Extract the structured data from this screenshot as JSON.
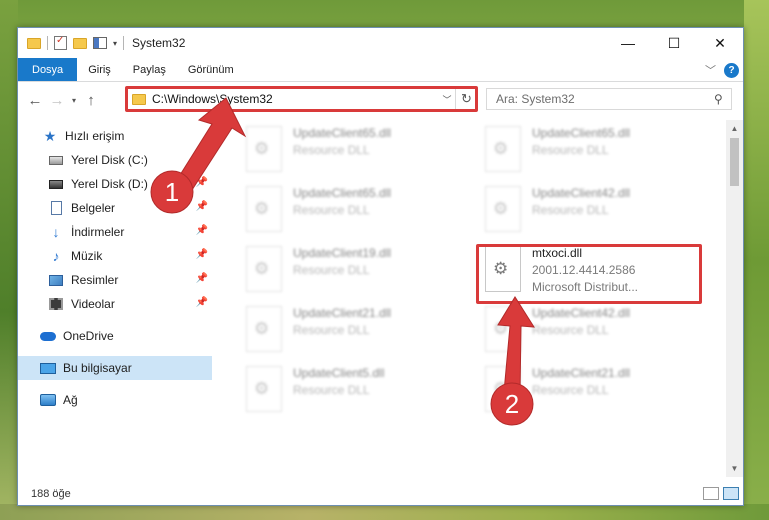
{
  "window": {
    "title": "System32",
    "controls": {
      "minimize": "—",
      "maximize": "☐",
      "close": "✕"
    }
  },
  "ribbon": {
    "tabs": [
      "Dosya",
      "Giriş",
      "Paylaş",
      "Görünüm"
    ],
    "help": "?"
  },
  "nav": {
    "address": "C:\\Windows\\System32",
    "search_placeholder": "Ara: System32"
  },
  "sidebar": {
    "items": [
      {
        "label": "Hızlı erişim",
        "icon": "star-icon"
      },
      {
        "label": "Yerel Disk (C:)",
        "icon": "disk-icon"
      },
      {
        "label": "Yerel Disk (D:)",
        "icon": "disk-icon"
      },
      {
        "label": "Belgeler",
        "icon": "documents-icon"
      },
      {
        "label": "İndirmeler",
        "icon": "download-icon"
      },
      {
        "label": "Müzik",
        "icon": "music-icon"
      },
      {
        "label": "Resimler",
        "icon": "pictures-icon"
      },
      {
        "label": "Videolar",
        "icon": "videos-icon"
      },
      {
        "label": "OneDrive",
        "icon": "cloud-icon"
      },
      {
        "label": "Bu bilgisayar",
        "icon": "computer-icon"
      },
      {
        "label": "Ağ",
        "icon": "network-icon"
      }
    ]
  },
  "files": [
    {
      "name": "UpdateClient65.dll",
      "type": "Resource DLL"
    },
    {
      "name": "UpdateClient65.dll",
      "type": "Resource DLL"
    },
    {
      "name": "UpdateClient65.dll",
      "type": "Resource DLL"
    },
    {
      "name": "UpdateClient42.dll",
      "type": "Resource DLL"
    },
    {
      "name": "UpdateClient19.dll",
      "type": "Resource DLL"
    },
    {
      "name": "mtxoci.dll",
      "version": "2001.12.4414.2586",
      "company": "Microsoft Distribut..."
    },
    {
      "name": "UpdateClient21.dll",
      "type": "Resource DLL"
    },
    {
      "name": "UpdateClient42.dll",
      "type": "Resource DLL"
    },
    {
      "name": "UpdateClient5.dll",
      "type": "Resource DLL"
    },
    {
      "name": "UpdateClient21.dll",
      "type": "Resource DLL"
    }
  ],
  "status": {
    "count": "188 öğe"
  },
  "callouts": {
    "one": "1",
    "two": "2",
    "color": "#d93a3a"
  }
}
